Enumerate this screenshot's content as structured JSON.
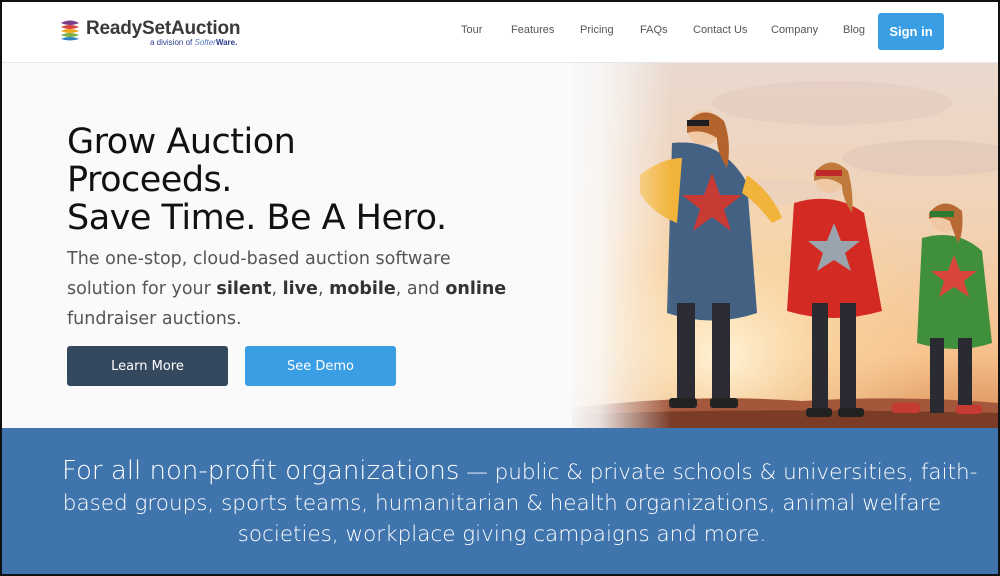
{
  "header": {
    "logo_name": "ReadySetAuction",
    "logo_sub_prefix": "a division of",
    "logo_sub_brand1": "Softer",
    "logo_sub_brand2": "Ware.",
    "nav": [
      "Tour",
      "Features",
      "Pricing",
      "FAQs",
      "Contact Us",
      "Company",
      "Blog"
    ],
    "signin_label": "Sign in"
  },
  "hero": {
    "headline": [
      "Grow Auction",
      "Proceeds.",
      "Save Time. Be A Hero."
    ],
    "sub_1": "The one-stop, cloud-based auction software solution for your ",
    "sub_silent": "silent",
    "sub_c1": ", ",
    "sub_live": "live",
    "sub_c2": ", ",
    "sub_mobile": "mobile",
    "sub_c3": ", and ",
    "sub_online": "online",
    "sub_2": " fundraiser auctions.",
    "learn_more_label": "Learn More",
    "see_demo_label": "See Demo"
  },
  "band": {
    "lead": "For all non-profit organizations",
    "line1": " — public & private schools & universities, faith-",
    "line2": "based groups, sports teams, humanitarian & health organizations, animal welfare",
    "line3": "societies, workplace giving campaigns and more."
  },
  "colors": {
    "accent_blue": "#3a9ee4",
    "dark_button": "#34495e",
    "band_blue": "#3f74ad"
  }
}
